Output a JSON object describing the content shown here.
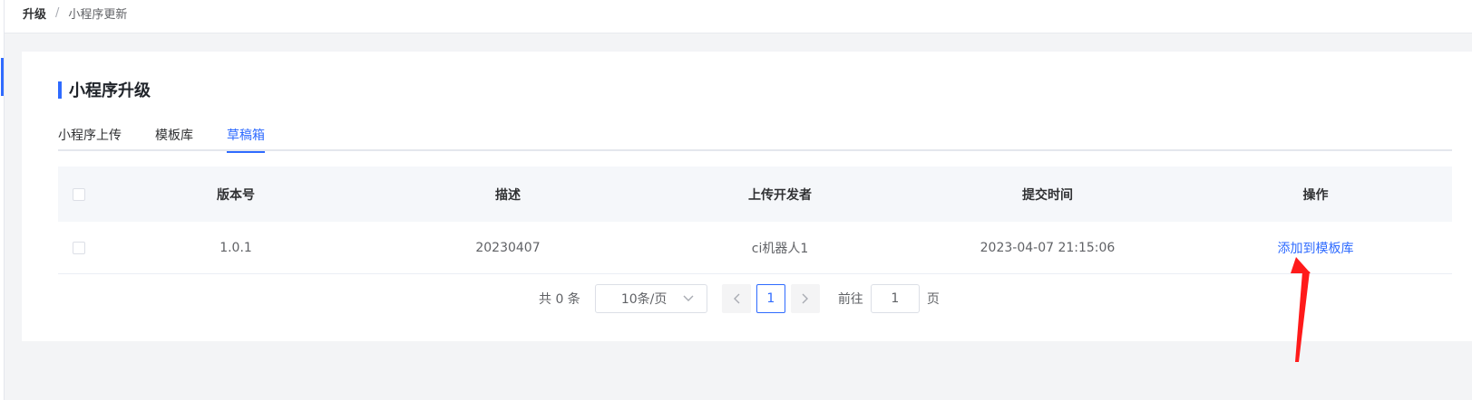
{
  "breadcrumb": {
    "root": "升级",
    "separator": "/",
    "current": "小程序更新"
  },
  "section": {
    "title": "小程序升级"
  },
  "tabs": [
    {
      "label": "小程序上传",
      "active": false
    },
    {
      "label": "模板库",
      "active": false
    },
    {
      "label": "草稿箱",
      "active": true
    }
  ],
  "table": {
    "columns": [
      "版本号",
      "描述",
      "上传开发者",
      "提交时间",
      "操作"
    ],
    "rows": [
      {
        "version": "1.0.1",
        "description": "20230407",
        "developer": "ci机器人1",
        "submitted": "2023-04-07 21:15:06",
        "action": "添加到模板库"
      }
    ]
  },
  "pagination": {
    "total": "共 0 条",
    "page_size": "10条/页",
    "current_page": "1",
    "prev_icon": "chevron-left-icon",
    "next_icon": "chevron-right-icon",
    "jump_label": "前往",
    "jump_value": "1",
    "jump_suffix": "页"
  },
  "colors": {
    "accent": "#2f6bff",
    "annotation": "#ff1a1a"
  }
}
